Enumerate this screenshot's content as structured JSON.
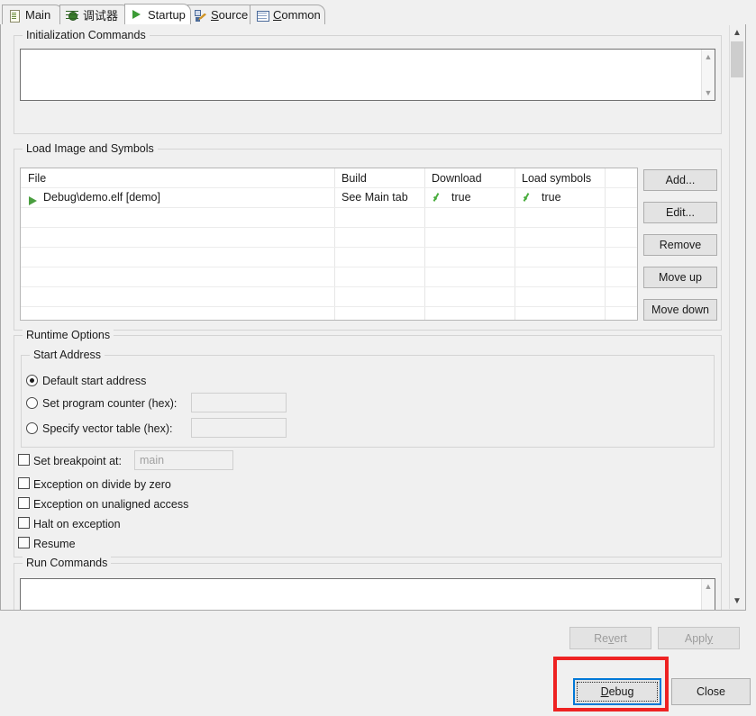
{
  "window": {
    "active_tab": "Startup"
  },
  "tabs": [
    {
      "label": "Main",
      "icon": "document-icon",
      "mnemonic": "",
      "active": false
    },
    {
      "label": "调试器",
      "icon": "bug-icon",
      "mnemonic": "",
      "active": false
    },
    {
      "label": "Startup",
      "icon": "play-icon",
      "mnemonic": "",
      "active": true
    },
    {
      "label": "Source",
      "icon": "source-icon",
      "mnemonic": "S",
      "active": false
    },
    {
      "label": "Common",
      "icon": "table-icon",
      "mnemonic": "C",
      "active": false
    }
  ],
  "initialization_commands": {
    "legend": "Initialization Commands",
    "value": ""
  },
  "load_image_and_symbols": {
    "legend": "Load Image and Symbols",
    "columns": [
      "File",
      "Build",
      "Download",
      "Load symbols"
    ],
    "rows": [
      {
        "file": "Debug\\demo.elf [demo]",
        "build": "See Main tab",
        "download": "true",
        "load_symbols": "true",
        "download_checked": true,
        "load_symbols_checked": true
      }
    ],
    "buttons": [
      {
        "label": "Add...",
        "enabled": true
      },
      {
        "label": "Edit...",
        "enabled": true
      },
      {
        "label": "Remove",
        "enabled": true
      },
      {
        "label": "Move up",
        "enabled": true
      },
      {
        "label": "Move down",
        "enabled": true
      }
    ]
  },
  "runtime_options": {
    "legend": "Runtime Options",
    "start_address": {
      "legend": "Start Address",
      "options": [
        {
          "label": "Default start address",
          "selected": true,
          "has_input": false,
          "value": ""
        },
        {
          "label": "Set program counter (hex):",
          "selected": false,
          "has_input": true,
          "value": ""
        },
        {
          "label": "Specify vector table (hex):",
          "selected": false,
          "has_input": true,
          "value": ""
        }
      ]
    },
    "checkboxes": [
      {
        "label": "Set breakpoint at:",
        "checked": false,
        "has_input": true,
        "input_value": "main"
      },
      {
        "label": "Exception on divide by zero",
        "checked": false,
        "has_input": false
      },
      {
        "label": "Exception on unaligned access",
        "checked": false,
        "has_input": false
      },
      {
        "label": "Halt on exception",
        "checked": false,
        "has_input": false
      },
      {
        "label": "Resume",
        "checked": false,
        "has_input": false
      }
    ]
  },
  "run_commands": {
    "legend": "Run Commands",
    "value": ""
  },
  "footer": {
    "revert_label": "Revert",
    "revert_mnemonic": "v",
    "revert_enabled": false,
    "apply_label": "Apply",
    "apply_mnemonic": "y",
    "apply_enabled": false,
    "debug_label": "Debug",
    "debug_mnemonic": "D",
    "debug_focused": true,
    "close_label": "Close"
  },
  "annotation": {
    "color": "#ee2222",
    "target": "Debug"
  }
}
